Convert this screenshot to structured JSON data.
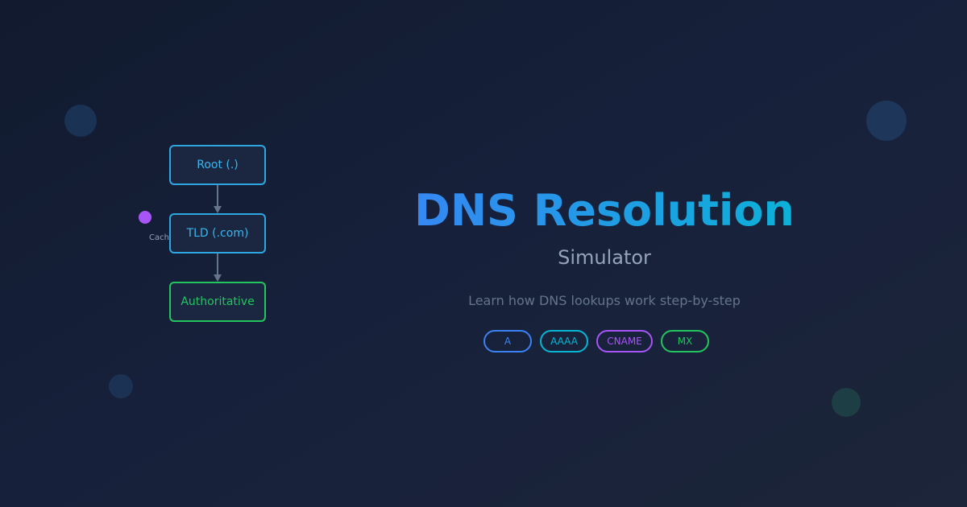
{
  "diagram": {
    "nodes": [
      {
        "label": "Root (.)"
      },
      {
        "label": "TLD (.com)"
      },
      {
        "label": "Authoritative"
      }
    ],
    "cache_label": "Cache"
  },
  "hero": {
    "title": "DNS Resolution",
    "subtitle": "Simulator",
    "tagline": "Learn how DNS lookups work step-by-step"
  },
  "record_types": [
    {
      "label": "A",
      "color": "#3b82f6"
    },
    {
      "label": "AAAA",
      "color": "#06b6d4"
    },
    {
      "label": "CNAME",
      "color": "#a855f7"
    },
    {
      "label": "MX",
      "color": "#22c55e"
    }
  ],
  "colors": {
    "background": "#16203a",
    "node_border": "#2ea7e0",
    "authoritative": "#22c55e",
    "cache": "#a855f7",
    "title_gradient_start": "#3b82f6",
    "title_gradient_end": "#06b6d4"
  }
}
